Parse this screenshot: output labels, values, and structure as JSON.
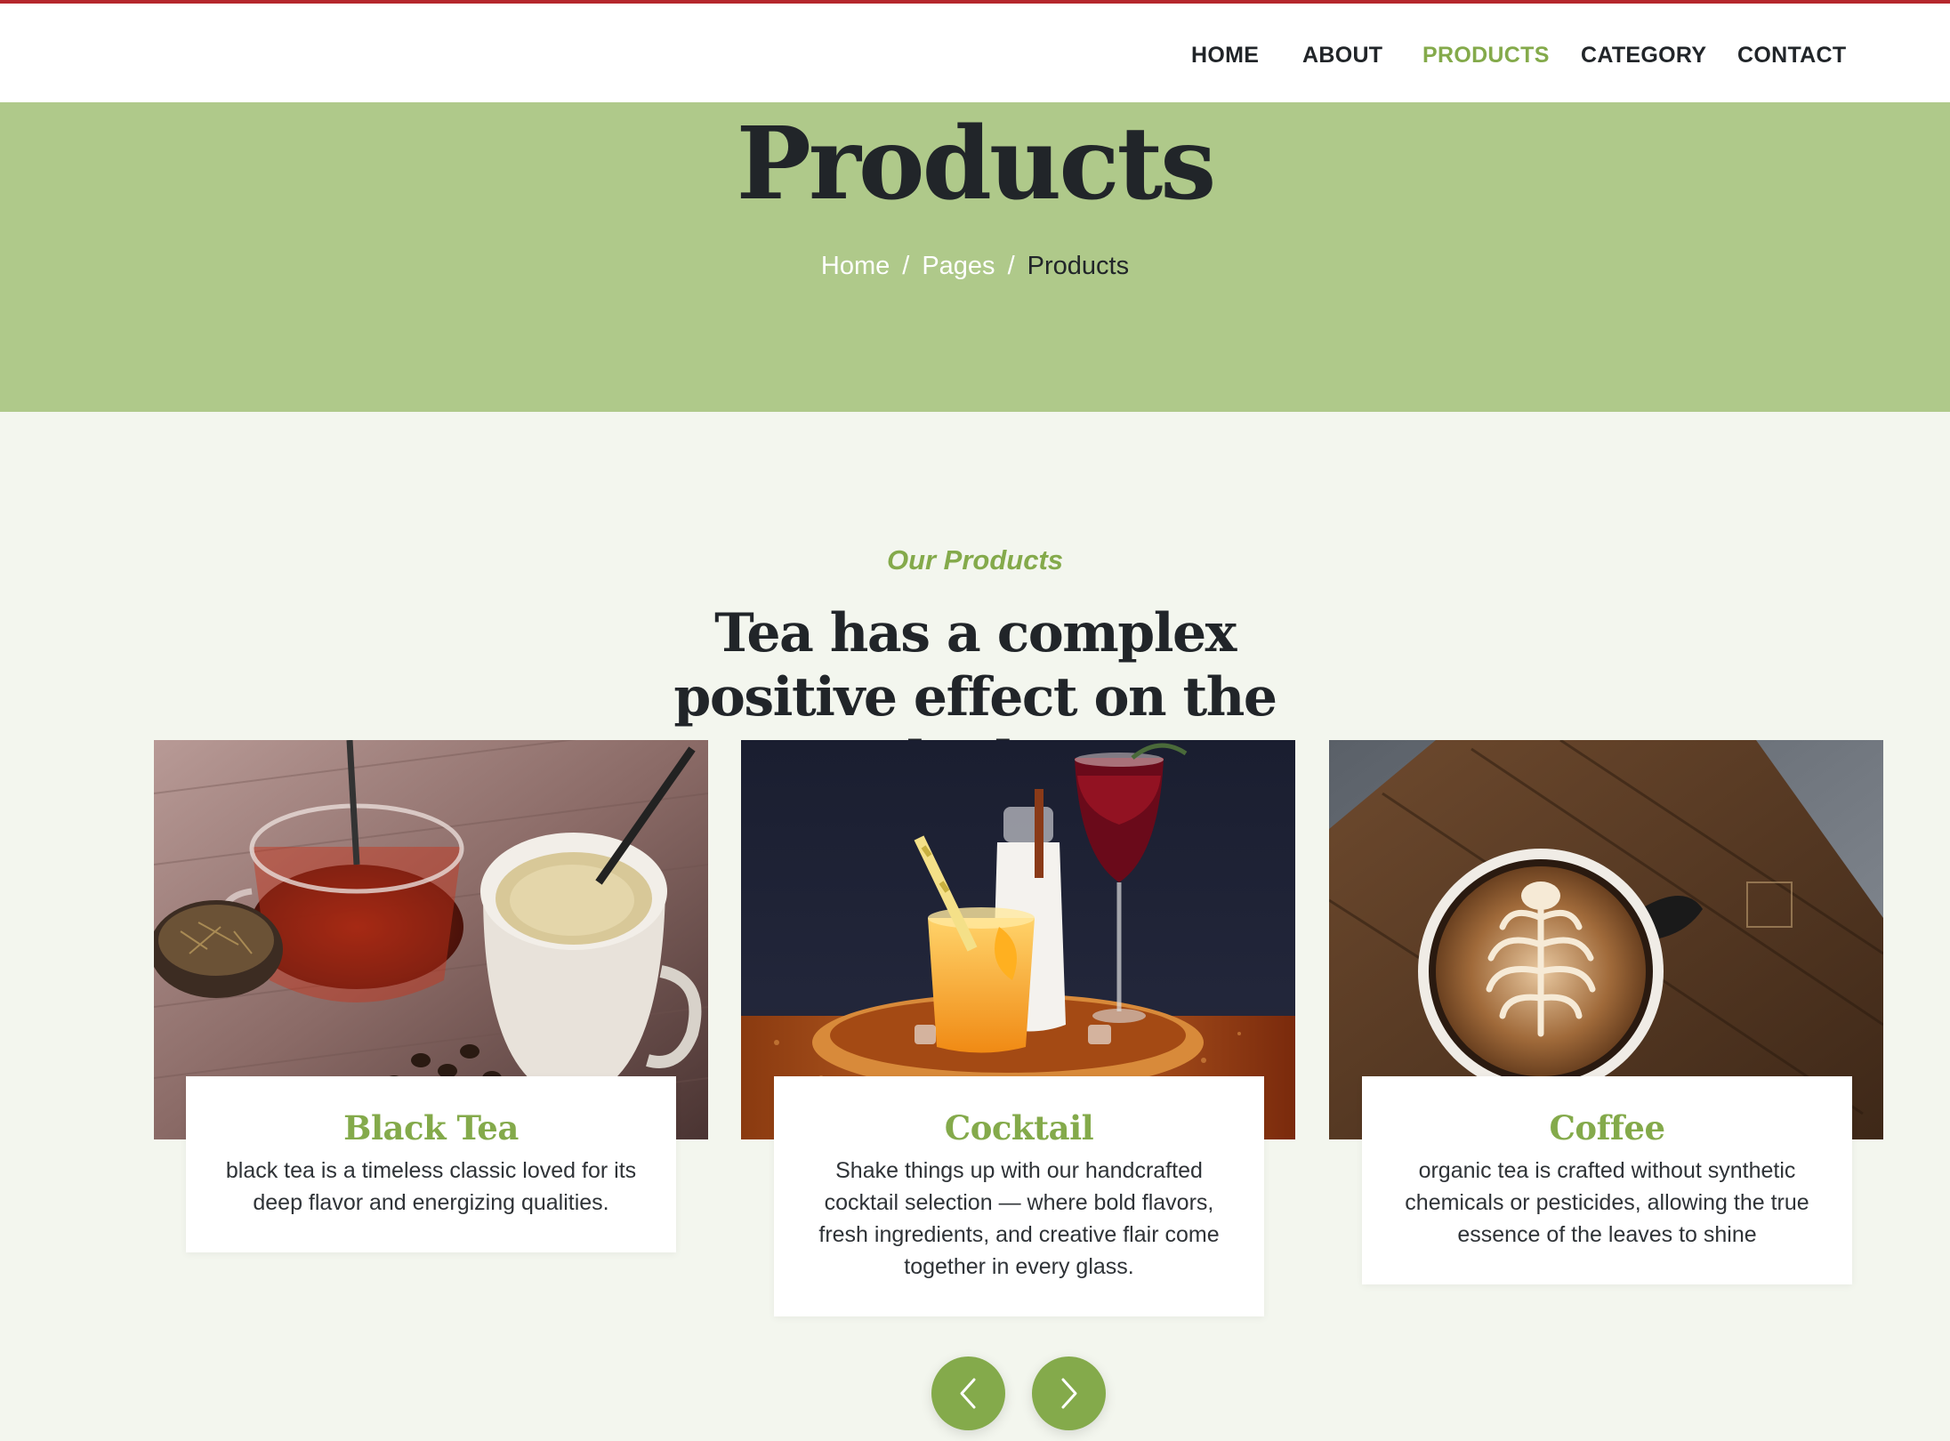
{
  "nav": {
    "items": [
      {
        "label": "HOME",
        "active": false
      },
      {
        "label": "ABOUT",
        "active": false
      },
      {
        "label": "PRODUCTS",
        "active": true
      },
      {
        "label": "CATEGORY",
        "active": false
      },
      {
        "label": "CONTACT",
        "active": false
      }
    ]
  },
  "hero": {
    "title": "Products",
    "breadcrumb": [
      "Home",
      "Pages",
      "Products"
    ],
    "separator": "/"
  },
  "section": {
    "subtitle": "Our Products",
    "title": "Tea has a complex positive effect on the body"
  },
  "products": [
    {
      "name": "Black Tea",
      "description": "black tea is a timeless classic loved for its deep flavor and energizing qualities.",
      "image": "black-tea-cups-photo"
    },
    {
      "name": "Cocktail",
      "description": "Shake things up with our handcrafted cocktail selection — where bold flavors, fresh ingredients, and creative flair come together in every glass.",
      "image": "cocktail-drinks-photo"
    },
    {
      "name": "Coffee",
      "description": "organic tea is crafted without synthetic chemicals or pesticides, allowing the true essence of the leaves to shine",
      "image": "latte-art-coffee-photo"
    }
  ],
  "carousel": {
    "prev_icon": "chevron-left-icon",
    "next_icon": "chevron-right-icon"
  },
  "colors": {
    "accent": "#84aa4b",
    "hero_bg": "#afc98a",
    "page_bg": "#f3f6ee",
    "top_line": "#b5272d",
    "text_dark": "#212529"
  }
}
